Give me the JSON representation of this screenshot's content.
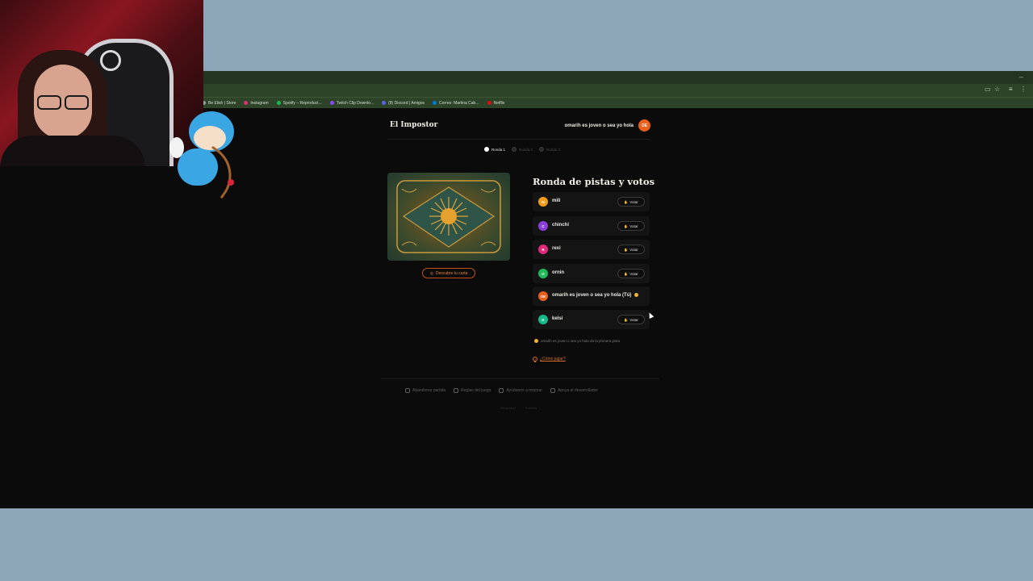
{
  "browser": {
    "bookmarks": [
      {
        "label": "Be Elish | Store",
        "color": "#9aa0a6"
      },
      {
        "label": "Instagram",
        "color": "#e1306c"
      },
      {
        "label": "Spotify – Reproduct...",
        "color": "#1db954"
      },
      {
        "label": "Twitch Clip Downlo...",
        "color": "#9146ff"
      },
      {
        "label": "(8) Discord | Amigos",
        "color": "#5865f2"
      },
      {
        "label": "Correo: Martina Cab...",
        "color": "#0078d4"
      },
      {
        "label": "Netflix",
        "color": "#e50914"
      }
    ]
  },
  "header": {
    "site_title": "El Impostor",
    "user_name": "omarih es joven o sea yo hola",
    "user_initials": "OE"
  },
  "rounds": [
    {
      "label": "Ronda 1",
      "state": "active"
    },
    {
      "label": "Ronda 2",
      "state": "inactive"
    },
    {
      "label": "Ronda 3",
      "state": "inactive"
    }
  ],
  "card": {
    "reveal_label": "Descubre tu carta"
  },
  "panel": {
    "title": "Ronda de pistas y votos",
    "vote_label": "Votar",
    "players": [
      {
        "name": "mili",
        "initial": "M",
        "color": "#f29a1a",
        "can_vote": true
      },
      {
        "name": "chinchi",
        "initial": "C",
        "color": "#8b3fd9",
        "can_vote": true
      },
      {
        "name": "rexi",
        "initial": "R",
        "color": "#e0287a",
        "can_vote": true
      },
      {
        "name": "ornin",
        "initial": "O",
        "color": "#20b85a",
        "can_vote": true
      },
      {
        "name": "omarih es joven o sea yo hola (Tú)",
        "initial": "OE",
        "color": "#e8601c",
        "can_vote": false
      },
      {
        "name": "kelsi",
        "initial": "K",
        "color": "#17b88a",
        "can_vote": true
      }
    ],
    "hint_text": "omarih es joven o sea yo hola da la primera pista",
    "how_to_play": "¿Cómo jugar?"
  },
  "footer": {
    "links": [
      "Abandonar partida",
      "Reglas del juego",
      "Ayúdanos a mejorar",
      "Apoya al desarrollador"
    ],
    "legal": [
      "Privacidad",
      "Cookies"
    ]
  },
  "colors": {
    "accent": "#e8601c",
    "background": "#0b0b0b",
    "frame": "#8da7b8"
  }
}
